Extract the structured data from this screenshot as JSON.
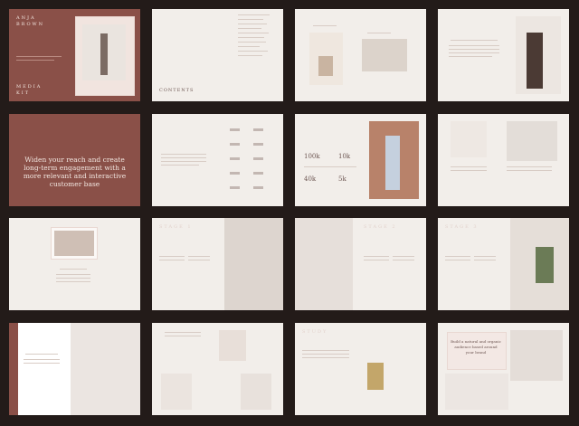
{
  "cover": {
    "name_line1": "ANJA",
    "name_line2": "BROWN",
    "kit_line1": "MEDIA",
    "kit_line2": "KIT"
  },
  "contents": {
    "title": "CONTENTS"
  },
  "row2": {
    "tagline": "Widen your reach and create long-term engagement with a more relevant and interactive customer base"
  },
  "stages": {
    "stage1": "STAGE 1",
    "stage2": "STAGE 2",
    "stage3": "STAGE 3",
    "study": "STUDY"
  },
  "stats": {
    "s1": "100k",
    "s2": "10k",
    "s3": "40k",
    "s4": "5k"
  },
  "quote": {
    "line": "Build a natural and organic audience based around your brand"
  }
}
